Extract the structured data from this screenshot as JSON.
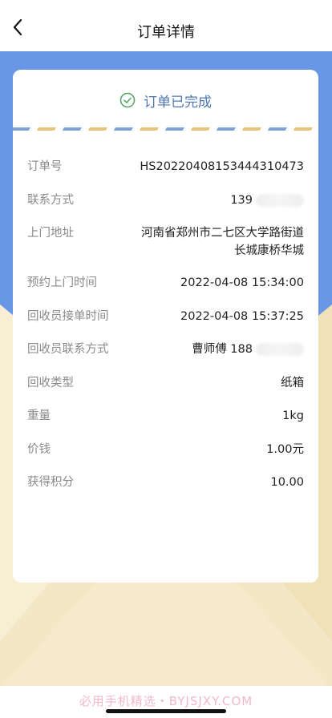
{
  "nav": {
    "title": "订单详情",
    "back_icon": "chevron-left-icon"
  },
  "status": {
    "text": "订单已完成",
    "icon": "check-circle-icon",
    "color": "#58A66B"
  },
  "colors": {
    "background_blue": "#6A96E6",
    "envelope": "#F2E6C4",
    "label": "#8a8a8a"
  },
  "details": [
    {
      "label": "订单号",
      "value": "HS20220408153444310473"
    },
    {
      "label": "联系方式",
      "value": "139"
    },
    {
      "label": "上门地址",
      "value": "河南省郑州市二七区大学路街道\n长城康桥华城"
    },
    {
      "label": "预约上门时间",
      "value": "2022-04-08 15:34:00"
    },
    {
      "label": "回收员接单时间",
      "value": "2022-04-08 15:37:25"
    },
    {
      "label": "回收员联系方式",
      "value": "曹师傅 188"
    },
    {
      "label": "回收类型",
      "value": "纸箱"
    },
    {
      "label": "重量",
      "value": "1kg"
    },
    {
      "label": "价钱",
      "value": "1.00元"
    },
    {
      "label": "获得积分",
      "value": "10.00"
    }
  ],
  "watermark": "必用手机精选・BYJSJXY.COM"
}
